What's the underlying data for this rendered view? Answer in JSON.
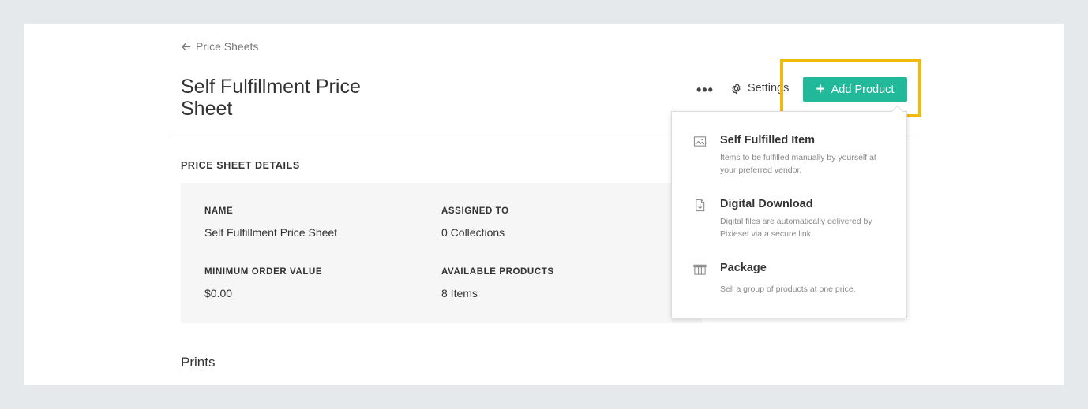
{
  "back_link": {
    "label": "Price Sheets"
  },
  "page_title": "Self Fulfillment Price Sheet",
  "header": {
    "more_label": "•••",
    "settings_label": "Settings",
    "add_product_label": "Add Product"
  },
  "details": {
    "section_title": "PRICE SHEET DETAILS",
    "fields": [
      {
        "label": "NAME",
        "value": "Self Fulfillment Price Sheet"
      },
      {
        "label": "ASSIGNED TO",
        "value": "0 Collections"
      },
      {
        "label": "MINIMUM ORDER VALUE",
        "value": "$0.00"
      },
      {
        "label": "AVAILABLE PRODUCTS",
        "value": "8 Items"
      }
    ]
  },
  "section_prints": "Prints",
  "dropdown": {
    "items": [
      {
        "title": "Self Fulfilled Item",
        "desc": "Items to be fulfilled manually by yourself at your preferred vendor.",
        "icon": "image-icon"
      },
      {
        "title": "Digital Download",
        "desc": "Digital files are automatically delivered by Pixieset via a secure link.",
        "icon": "file-download-icon"
      },
      {
        "title": "Package",
        "desc": "Sell a group of products at one price.",
        "icon": "gift-box-icon"
      }
    ]
  },
  "colors": {
    "accent": "#21b99a",
    "highlight": "#f0b90d",
    "background": "#e6e9ec"
  }
}
